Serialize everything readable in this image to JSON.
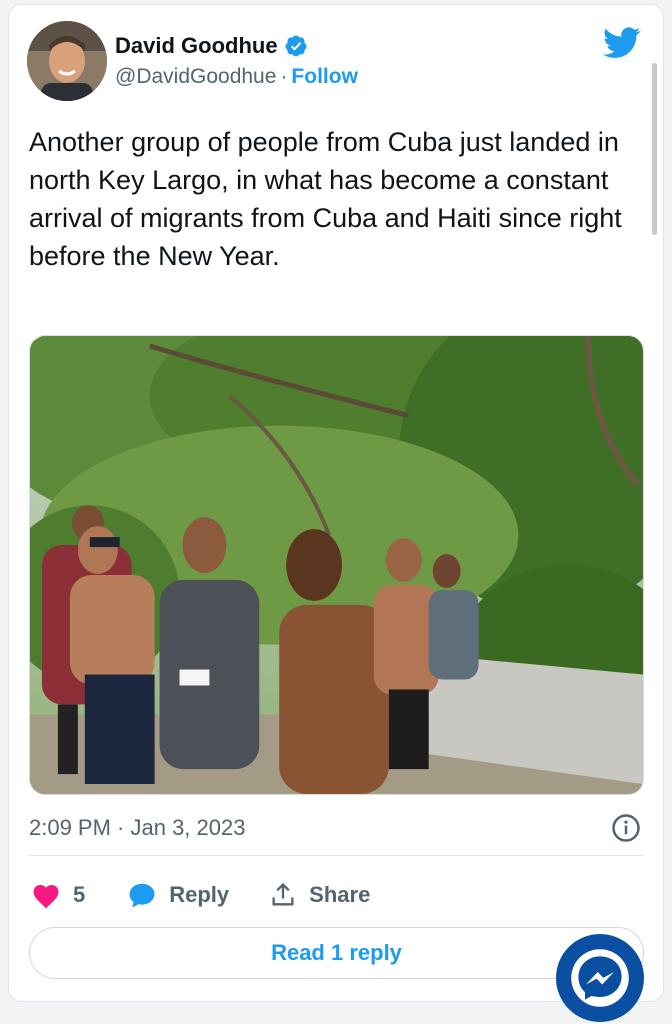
{
  "author": {
    "name": "David Goodhue",
    "handle": "@DavidGoodhue",
    "separator": "·",
    "follow_label": "Follow",
    "verified": true
  },
  "tweet": {
    "text": "Another group of people from Cuba just landed in north Key Largo, in what has become a constant arrival of migrants from Cuba and Haiti since right before the New Year.",
    "timestamp": "2:09 PM · Jan 3, 2023"
  },
  "actions": {
    "like_count": "5",
    "reply_label": "Reply",
    "share_label": "Share"
  },
  "read_replies_label": "Read 1 reply",
  "icons": {
    "verified": "verified-badge-icon",
    "twitter": "twitter-bird-icon",
    "info": "info-icon",
    "like": "heart-icon",
    "reply": "reply-bubble-icon",
    "share": "share-icon",
    "messenger": "messenger-icon"
  },
  "colors": {
    "accent": "#1d9bf0",
    "like": "#f91880",
    "text": "#0f1419",
    "muted": "#536471",
    "messenger": "#0b4fa3"
  }
}
